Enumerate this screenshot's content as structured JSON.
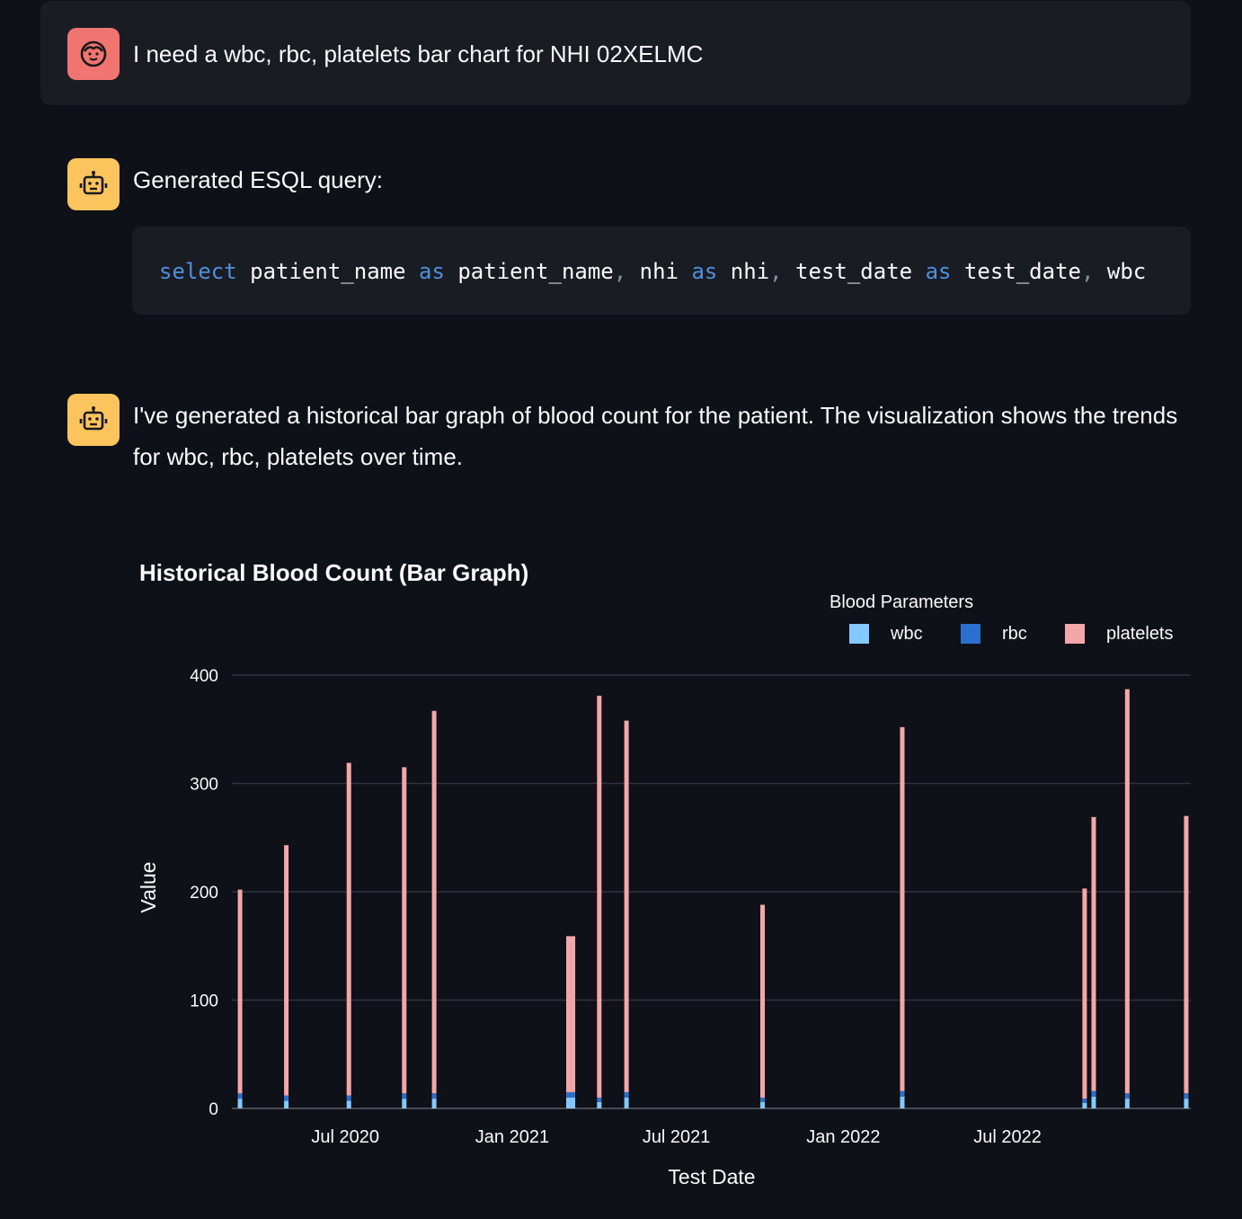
{
  "messages": [
    {
      "role": "user",
      "text": "I need a wbc, rbc, platelets bar chart for NHI 02XELMC"
    },
    {
      "role": "assistant",
      "text": "Generated ESQL query:"
    },
    {
      "role": "assistant",
      "text": "I've generated a historical bar graph of blood count for the patient. The visualization shows the trends for wbc, rbc, platelets over time."
    }
  ],
  "code": {
    "tokens": [
      {
        "t": "select",
        "k": "kw"
      },
      {
        "t": " patient_name ",
        "k": "id"
      },
      {
        "t": "as",
        "k": "kw"
      },
      {
        "t": " patient_name",
        "k": "id"
      },
      {
        "t": ",",
        "k": "punct"
      },
      {
        "t": " nhi ",
        "k": "id"
      },
      {
        "t": "as",
        "k": "kw"
      },
      {
        "t": " nhi",
        "k": "id"
      },
      {
        "t": ",",
        "k": "punct"
      },
      {
        "t": " test_date ",
        "k": "id"
      },
      {
        "t": "as",
        "k": "kw"
      },
      {
        "t": " test_date",
        "k": "id"
      },
      {
        "t": ",",
        "k": "punct"
      },
      {
        "t": " wbc",
        "k": "id"
      }
    ]
  },
  "colors": {
    "background": "#0e1117",
    "card": "#1a1c24",
    "user_avatar": "#f07470",
    "bot_avatar": "#fbc45d",
    "keyword": "#4f8fdc"
  },
  "icons": {
    "user_avatar": "face-icon",
    "bot_avatar": "robot-icon"
  },
  "chart_data": {
    "type": "bar",
    "barmode": "stack",
    "title": "Historical Blood Count (Bar Graph)",
    "xlabel": "Test Date",
    "ylabel": "Value",
    "legend_title": "Blood Parameters",
    "legend_position": "top-right",
    "grid": true,
    "ylim": [
      0,
      400
    ],
    "yticks": [
      0,
      100,
      200,
      300,
      400
    ],
    "xticks": [
      "2020-07-01",
      "2021-01-01",
      "2021-07-01",
      "2022-01-01",
      "2022-07-01"
    ],
    "xtick_labels": [
      "Jul 2020",
      "Jan 2021",
      "Jul 2021",
      "Jan 2022",
      "Jul 2022"
    ],
    "xlim": [
      "2020-02-27",
      "2023-01-19"
    ],
    "x": [
      "2020-03-07",
      "2020-04-27",
      "2020-07-05",
      "2020-09-04",
      "2020-10-07",
      "2021-03-04",
      "2021-03-09",
      "2021-04-07",
      "2021-05-07",
      "2021-10-04",
      "2022-03-07",
      "2022-09-24",
      "2022-10-04",
      "2022-11-10",
      "2023-01-14"
    ],
    "series": [
      {
        "name": "wbc",
        "color": "#83c9ff",
        "values": [
          9,
          7,
          7,
          9,
          9,
          10,
          10,
          6,
          10,
          6,
          11,
          5,
          11,
          9,
          9
        ]
      },
      {
        "name": "rbc",
        "color": "#0068c9",
        "values": [
          5,
          5,
          5,
          5,
          5,
          5,
          5,
          4,
          5,
          4,
          5,
          4,
          5,
          5,
          5
        ]
      },
      {
        "name": "platelets",
        "color": "#ffabab",
        "values": [
          188,
          231,
          307,
          301,
          353,
          144,
          144,
          371,
          343,
          178,
          336,
          194,
          253,
          373,
          256
        ]
      }
    ]
  }
}
